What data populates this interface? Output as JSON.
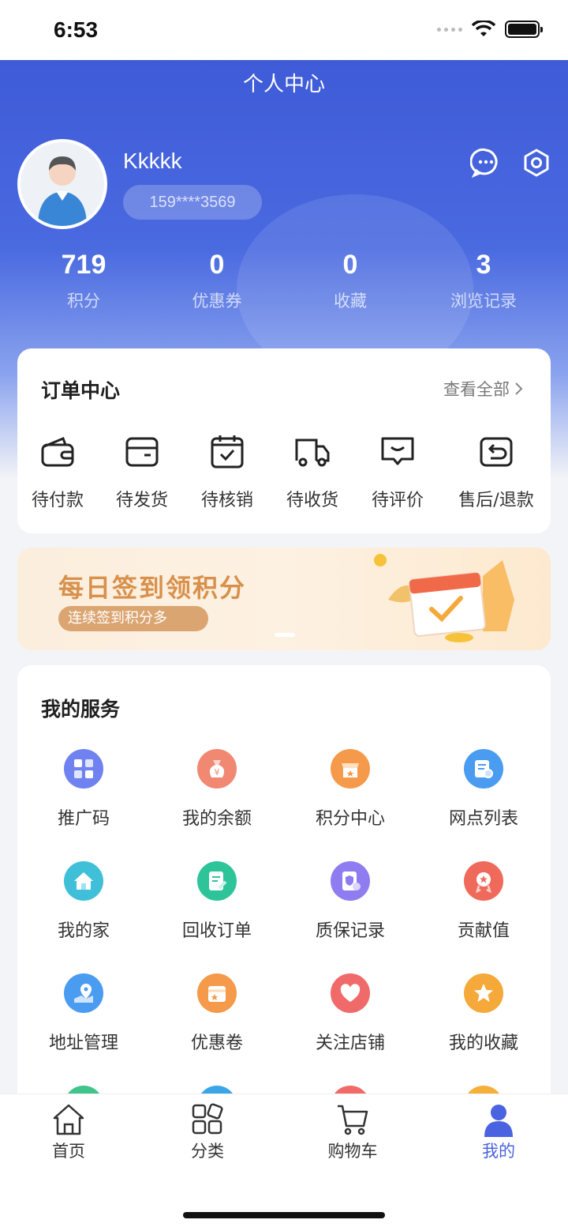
{
  "status_bar": {
    "time": "6:53"
  },
  "header": {
    "title": "个人中心"
  },
  "profile": {
    "username": "Kkkkk",
    "phone": "159****3569"
  },
  "stats": [
    {
      "value": "719",
      "label": "积分"
    },
    {
      "value": "0",
      "label": "优惠券"
    },
    {
      "value": "0",
      "label": "收藏"
    },
    {
      "value": "3",
      "label": "浏览记录"
    }
  ],
  "orders": {
    "title": "订单中心",
    "view_all": "查看全部",
    "items": [
      {
        "label": "待付款",
        "icon": "wallet-icon"
      },
      {
        "label": "待发货",
        "icon": "card-icon"
      },
      {
        "label": "待核销",
        "icon": "calendar-check-icon"
      },
      {
        "label": "待收货",
        "icon": "truck-icon"
      },
      {
        "label": "待评价",
        "icon": "comment-icon"
      },
      {
        "label": "售后/退款",
        "icon": "return-icon"
      }
    ]
  },
  "banner": {
    "title": "每日签到领积分",
    "subtitle": "连续签到积分多"
  },
  "services": {
    "title": "我的服务",
    "items": [
      {
        "label": "推广码",
        "icon": "qrcode-icon",
        "color": "#6f82f0"
      },
      {
        "label": "我的余额",
        "icon": "money-bag-icon",
        "color": "#f08872"
      },
      {
        "label": "积分中心",
        "icon": "store-icon",
        "color": "#f59a4a"
      },
      {
        "label": "网点列表",
        "icon": "list-search-icon",
        "color": "#4a9cf0"
      },
      {
        "label": "我的家",
        "icon": "home-icon",
        "color": "#3fc0d8"
      },
      {
        "label": "回收订单",
        "icon": "doc-edit-icon",
        "color": "#2ec49a"
      },
      {
        "label": "质保记录",
        "icon": "shield-doc-icon",
        "color": "#8f7cf0"
      },
      {
        "label": "贡献值",
        "icon": "medal-icon",
        "color": "#f06a5c"
      },
      {
        "label": "地址管理",
        "icon": "location-icon",
        "color": "#4a9cf0"
      },
      {
        "label": "优惠卷",
        "icon": "coupon-icon",
        "color": "#f59a4a"
      },
      {
        "label": "关注店铺",
        "icon": "heart-icon",
        "color": "#f06a6a"
      },
      {
        "label": "我的收藏",
        "icon": "star-icon",
        "color": "#f5a93a"
      }
    ]
  },
  "tabbar": [
    {
      "label": "首页",
      "icon": "home-tab-icon",
      "active": false
    },
    {
      "label": "分类",
      "icon": "category-tab-icon",
      "active": false
    },
    {
      "label": "购物车",
      "icon": "cart-tab-icon",
      "active": false
    },
    {
      "label": "我的",
      "icon": "user-tab-icon",
      "active": true
    }
  ],
  "colors": {
    "primary": "#4a63e0",
    "banner_text": "#d8914c"
  }
}
